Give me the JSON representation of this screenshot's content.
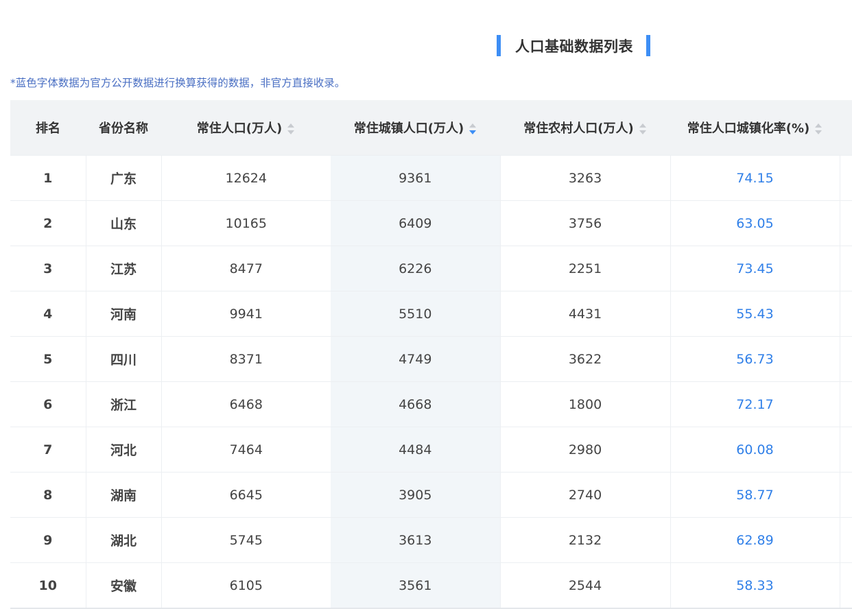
{
  "title": "人口基础数据列表",
  "note": "*蓝色字体数据为官方公开数据进行换算获得的数据，非官方直接收录。",
  "accent_color": "#3d8ef5",
  "computed_value_color": "#2f7fe8",
  "table": {
    "headers": [
      "排名",
      "省份名称",
      "常住人口(万人)",
      "常住城镇人口(万人)",
      "常住农村人口(万人)",
      "常住人口城镇化率(%)"
    ],
    "sorted_column": "常住城镇人口(万人)",
    "sort_direction": "descending",
    "rows": [
      {
        "rank": "1",
        "province": "广东",
        "population": "12624",
        "urban": "9361",
        "rural": "3263",
        "rate": "74.15"
      },
      {
        "rank": "2",
        "province": "山东",
        "population": "10165",
        "urban": "6409",
        "rural": "3756",
        "rate": "63.05"
      },
      {
        "rank": "3",
        "province": "江苏",
        "population": "8477",
        "urban": "6226",
        "rural": "2251",
        "rate": "73.45"
      },
      {
        "rank": "4",
        "province": "河南",
        "population": "9941",
        "urban": "5510",
        "rural": "4431",
        "rate": "55.43"
      },
      {
        "rank": "5",
        "province": "四川",
        "population": "8371",
        "urban": "4749",
        "rural": "3622",
        "rate": "56.73"
      },
      {
        "rank": "6",
        "province": "浙江",
        "population": "6468",
        "urban": "4668",
        "rural": "1800",
        "rate": "72.17"
      },
      {
        "rank": "7",
        "province": "河北",
        "population": "7464",
        "urban": "4484",
        "rural": "2980",
        "rate": "60.08"
      },
      {
        "rank": "8",
        "province": "湖南",
        "population": "6645",
        "urban": "3905",
        "rural": "2740",
        "rate": "58.77"
      },
      {
        "rank": "9",
        "province": "湖北",
        "population": "5745",
        "urban": "3613",
        "rural": "2132",
        "rate": "62.89"
      },
      {
        "rank": "10",
        "province": "安徽",
        "population": "6105",
        "urban": "3561",
        "rural": "2544",
        "rate": "58.33"
      }
    ]
  }
}
